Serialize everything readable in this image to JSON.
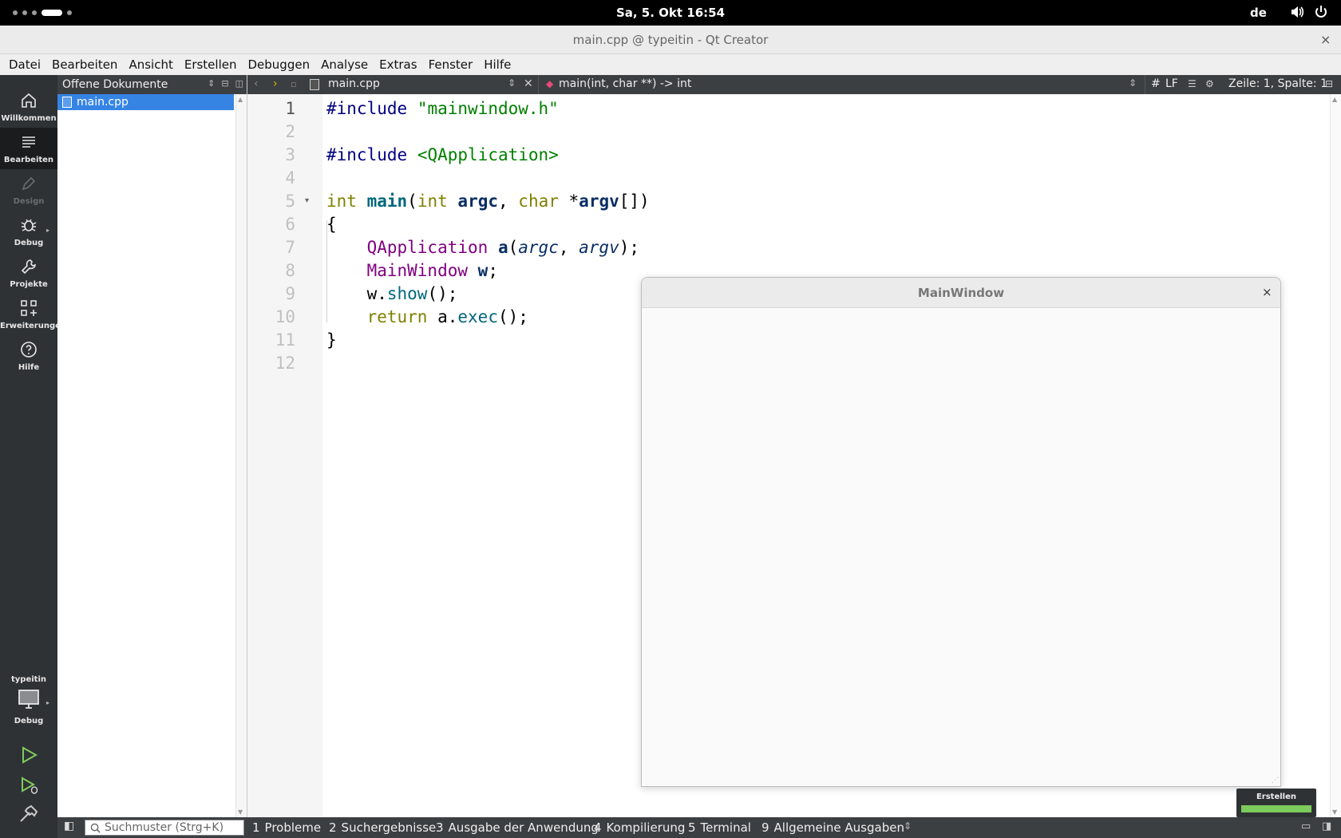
{
  "system_bar": {
    "clock": "Sa, 5. Okt  16:54",
    "keyboard_layout": "de"
  },
  "window": {
    "title": "main.cpp @ typeitin - Qt Creator",
    "close_glyph": "×"
  },
  "menu": {
    "items": [
      "Datei",
      "Bearbeiten",
      "Ansicht",
      "Erstellen",
      "Debuggen",
      "Analyse",
      "Extras",
      "Fenster",
      "Hilfe"
    ]
  },
  "modes": [
    {
      "label": "Willkommen",
      "icon": "home-icon"
    },
    {
      "label": "Bearbeiten",
      "icon": "edit-lines-icon"
    },
    {
      "label": "Design",
      "icon": "pen-icon"
    },
    {
      "label": "Debug",
      "icon": "bug-icon"
    },
    {
      "label": "Projekte",
      "icon": "wrench-icon"
    },
    {
      "label": "Erweiterungen",
      "icon": "extensions-icon"
    },
    {
      "label": "Hilfe",
      "icon": "help-icon"
    }
  ],
  "kit": {
    "project": "typeitin",
    "build_mode": "Debug"
  },
  "open_documents": {
    "header": "Offene Dokumente",
    "items": [
      "main.cpp"
    ]
  },
  "editor_toolbar": {
    "file": "main.cpp",
    "symbol": "main(int, char **) -> int",
    "hash": "#",
    "line_ending": "LF",
    "position": "Zeile: 1, Spalte: 1"
  },
  "editor": {
    "line_numbers": [
      "1",
      "2",
      "3",
      "4",
      "5",
      "6",
      "7",
      "8",
      "9",
      "10",
      "11",
      "12"
    ],
    "code": {
      "l1_pp": "#include",
      "l1_str": "\"mainwindow.h\"",
      "l3_pp": "#include",
      "l3_str": "<QApplication>",
      "l5_kw1": "int",
      "l5_fn": "main",
      "l5_p1": "(",
      "l5_kw2": "int",
      "l5_v1": "argc",
      "l5_p2": ", ",
      "l5_kw3": "char",
      "l5_p3": " *",
      "l5_v2": "argv",
      "l5_p4": "[])",
      "l6": "{",
      "l7_ty": "QApplication",
      "l7_v": "a",
      "l7_p1": "(",
      "l7_a1": "argc",
      "l7_p2": ", ",
      "l7_a2": "argv",
      "l7_p3": ");",
      "l8_ty": "MainWindow",
      "l8_v": "w",
      "l8_p": ";",
      "l9_obj": "w.",
      "l9_m": "show",
      "l9_p": "();",
      "l10_kw": "return",
      "l10_obj": "a.",
      "l10_m": "exec",
      "l10_p": "();",
      "l11": "}"
    }
  },
  "app_window": {
    "title": "MainWindow",
    "close_glyph": "×"
  },
  "build_progress": {
    "label": "Erstellen",
    "fraction": 1.0
  },
  "output_bar": {
    "search_placeholder": "Suchmuster (Strg+K)",
    "tabs": [
      {
        "num": "1",
        "label": "Probleme"
      },
      {
        "num": "2",
        "label": "Suchergebnisse"
      },
      {
        "num": "3",
        "label": "Ausgabe der Anwendung"
      },
      {
        "num": "4",
        "label": "Kompilierung"
      },
      {
        "num": "5",
        "label": "Terminal"
      },
      {
        "num": "9",
        "label": "Allgemeine Ausgaben"
      }
    ]
  },
  "colors": {
    "sidebar": "#2f3235",
    "selection": "#3584e4",
    "progress": "#7ecb5d"
  }
}
